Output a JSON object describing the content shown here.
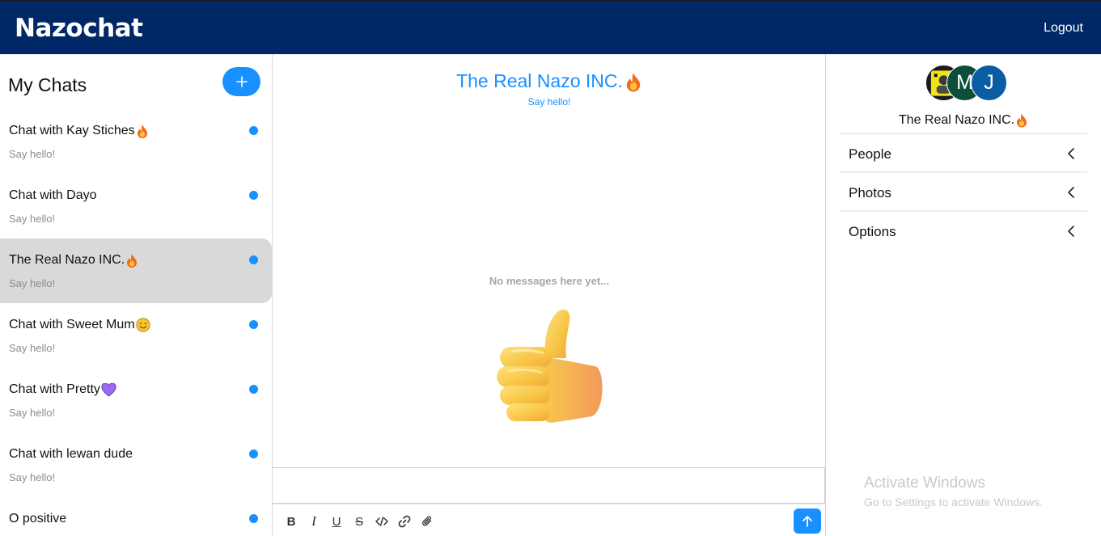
{
  "app": {
    "title": "Nazochat",
    "logout_label": "Logout"
  },
  "sidebar": {
    "title": "My Chats",
    "new_chat_icon": "plus-icon",
    "chats": [
      {
        "name": "Chat with Kay Stiches",
        "emoji": "fire",
        "preview": "Say hello!",
        "unread": true,
        "active": false
      },
      {
        "name": "Chat with Dayo",
        "emoji": "",
        "preview": "Say hello!",
        "unread": true,
        "active": false
      },
      {
        "name": "The Real Nazo INC.",
        "emoji": "fire",
        "preview": "Say hello!",
        "unread": true,
        "active": true
      },
      {
        "name": "Chat with Sweet Mum",
        "emoji": "smile",
        "preview": "Say hello!",
        "unread": true,
        "active": false
      },
      {
        "name": "Chat with Pretty",
        "emoji": "purple-heart",
        "preview": "Say hello!",
        "unread": true,
        "active": false
      },
      {
        "name": "Chat with lewan dude",
        "emoji": "",
        "preview": "Say hello!",
        "unread": true,
        "active": false
      },
      {
        "name": "O positive",
        "emoji": "",
        "preview": "",
        "unread": true,
        "active": false
      }
    ]
  },
  "conversation": {
    "title": "The Real Nazo INC.",
    "title_emoji": "fire",
    "subtitle": "Say hello!",
    "empty_text": "No messages here yet...",
    "empty_illustration": "thumbs-up-icon",
    "composer_value": "",
    "toolbar_icons": [
      "bold-icon",
      "italic-icon",
      "underline-icon",
      "strikethrough-icon",
      "code-icon",
      "link-icon",
      "attachment-icon"
    ],
    "toolbar_labels": {
      "bold": "B",
      "italic": "I",
      "underline": "U",
      "strike": "S"
    },
    "send_icon": "arrow-up-icon"
  },
  "details": {
    "name": "The Real Nazo INC.",
    "name_emoji": "fire",
    "avatars": [
      {
        "letter": "",
        "color": "#111111",
        "kind": "photo"
      },
      {
        "letter": "M",
        "color": "#0b4f3b"
      },
      {
        "letter": "J",
        "color": "#0a5ca3"
      }
    ],
    "sections": [
      {
        "label": "People"
      },
      {
        "label": "Photos"
      },
      {
        "label": "Options"
      }
    ]
  },
  "watermark": {
    "line1": "Activate Windows",
    "line2": "Go to Settings to activate Windows."
  },
  "colors": {
    "header": "#002766",
    "accent": "#1890ff",
    "active_row": "#d9d9d9"
  }
}
